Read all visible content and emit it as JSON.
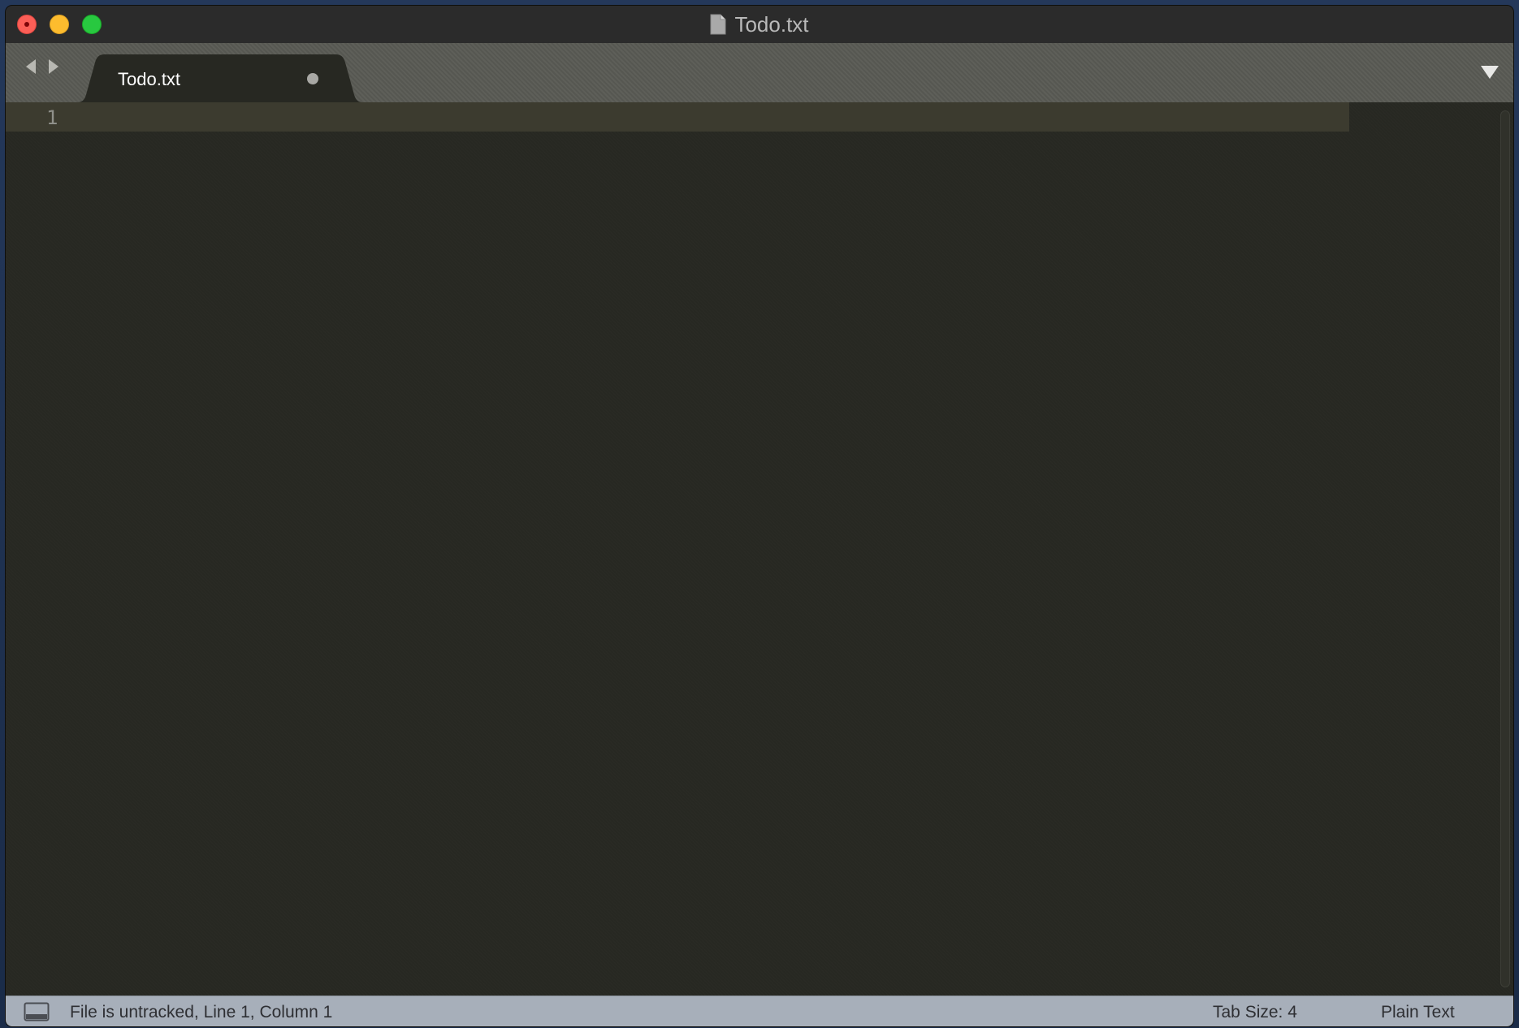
{
  "window": {
    "title": "Todo.txt",
    "title_icon": "document-icon"
  },
  "tabs": [
    {
      "label": "Todo.txt",
      "dirty": true,
      "active": true
    }
  ],
  "editor": {
    "line_numbers": [
      "1"
    ],
    "content": "",
    "current_line": 1,
    "current_line_color": "#3c3b2f",
    "background_color": "#272822"
  },
  "statusbar": {
    "message": "File is untracked, Line 1, Column 1",
    "tab_size": "Tab Size: 4",
    "syntax": "Plain Text",
    "background_color": "#a7afba"
  },
  "icons": {
    "nav_back": "chevron-left-icon",
    "nav_forward": "chevron-right-icon",
    "tab_menu": "triangle-down-icon",
    "panel_toggle": "panel-icon"
  },
  "colors": {
    "close": "#fc5f57",
    "minimize": "#fdbc2e",
    "maximize": "#28c840",
    "tabbar": "#595a54"
  }
}
